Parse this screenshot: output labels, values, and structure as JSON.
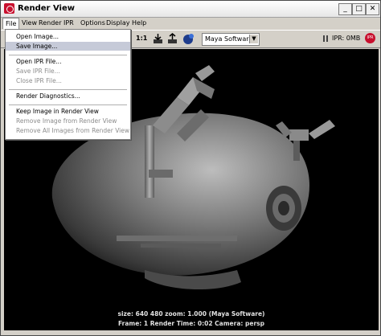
{
  "window": {
    "title": "Render View",
    "buttons": [
      "_",
      "□",
      "✕"
    ]
  },
  "menubar": [
    "File",
    "View",
    "Render",
    "IPR",
    "Options",
    "Display",
    "Help"
  ],
  "toolbar": {
    "ratio_label": "1:1",
    "renderer": "Maya Software",
    "ipr_memory": "IPR: 0MB",
    "ipr_badge": "IPR"
  },
  "file_menu": {
    "open_image": "Open Image...",
    "save_image": "Save Image...",
    "open_ipr": "Open IPR File...",
    "save_ipr": "Save IPR File...",
    "close_ipr": "Close IPR File...",
    "render_diagnostics": "Render Diagnostics...",
    "keep_image": "Keep Image in Render View",
    "remove_image": "Remove Image from Render View",
    "remove_all": "Remove All Images from Render View"
  },
  "status": {
    "line1": "size:  640  480 zoom: 1.000      (Maya Software)",
    "line2": "Frame: 1       Render Time: 0:02        Camera: persp"
  },
  "colors": {
    "highlight": "#c6cad8",
    "ipr_red": "#c8102e",
    "viewport_bg": "#000000"
  }
}
